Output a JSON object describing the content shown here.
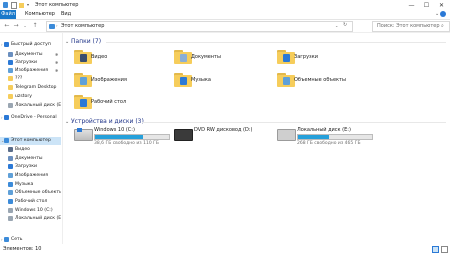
{
  "window": {
    "title": "Этот компьютер",
    "minimize_glyph": "—",
    "maximize_glyph": "☐",
    "close_glyph": "✕"
  },
  "ribbon": {
    "file_tab": "Файл",
    "tabs": [
      "Компьютер",
      "Вид"
    ]
  },
  "address": {
    "path": "Этот компьютер",
    "search_placeholder": "Поиск: Этот компьютер"
  },
  "nav_pane": {
    "items": [
      {
        "label": "Быстрый доступ",
        "icon": "star-icon",
        "color": "#2b79d6",
        "pinned": false,
        "level": 0
      },
      {
        "label": "Документы",
        "icon": "documents-icon",
        "color": "#6a8fbf",
        "pinned": true,
        "level": 1
      },
      {
        "label": "Загрузки",
        "icon": "downloads-icon",
        "color": "#2b79d6",
        "pinned": true,
        "level": 1
      },
      {
        "label": "Изображения",
        "icon": "pictures-icon",
        "color": "#5fa0d8",
        "pinned": true,
        "level": 1
      },
      {
        "label": "???",
        "icon": "folder-icon",
        "color": "#f6cd5b",
        "pinned": false,
        "level": 1
      },
      {
        "label": "Telegram Desktop",
        "icon": "folder-icon",
        "color": "#f6cd5b",
        "pinned": false,
        "level": 1
      },
      {
        "label": "uzstory",
        "icon": "folder-icon",
        "color": "#f6cd5b",
        "pinned": false,
        "level": 1
      },
      {
        "label": "Локальный диск (E:)",
        "icon": "drive-icon",
        "color": "#9aa6b2",
        "pinned": false,
        "level": 1
      },
      {
        "label": "OneDrive - Personal",
        "icon": "onedrive-icon",
        "color": "#2b79d6",
        "pinned": false,
        "level": 0
      },
      {
        "label": "Этот компьютер",
        "icon": "computer-icon",
        "color": "#3c8bd9",
        "pinned": false,
        "level": 0,
        "selected": true
      },
      {
        "label": "Видео",
        "icon": "video-icon",
        "color": "#5a6d8a",
        "pinned": false,
        "level": 1
      },
      {
        "label": "Документы",
        "icon": "documents-icon",
        "color": "#6a8fbf",
        "pinned": false,
        "level": 1
      },
      {
        "label": "Загрузки",
        "icon": "downloads-icon",
        "color": "#2b79d6",
        "pinned": false,
        "level": 1
      },
      {
        "label": "Изображения",
        "icon": "pictures-icon",
        "color": "#5fa0d8",
        "pinned": false,
        "level": 1
      },
      {
        "label": "Музыка",
        "icon": "music-icon",
        "color": "#3c8bd9",
        "pinned": false,
        "level": 1
      },
      {
        "label": "Объемные объекты",
        "icon": "3d-objects-icon",
        "color": "#5fa0d8",
        "pinned": false,
        "level": 1
      },
      {
        "label": "Рабочий стол",
        "icon": "desktop-icon",
        "color": "#3c8bd9",
        "pinned": false,
        "level": 1
      },
      {
        "label": "Windows 10 (C:)",
        "icon": "drive-icon",
        "color": "#9aa6b2",
        "pinned": false,
        "level": 1
      },
      {
        "label": "Локальный диск (E:)",
        "icon": "drive-icon",
        "color": "#9aa6b2",
        "pinned": false,
        "level": 1
      },
      {
        "label": "Сеть",
        "icon": "network-icon",
        "color": "#3c8bd9",
        "pinned": false,
        "level": 0
      }
    ]
  },
  "folders_section": {
    "header": "Папки (7)",
    "items": [
      {
        "label": "Видео",
        "icon": "video-folder-icon",
        "accent": "#3a4e6f"
      },
      {
        "label": "Документы",
        "icon": "documents-folder-icon",
        "accent": "#8aaed6"
      },
      {
        "label": "Загрузки",
        "icon": "downloads-folder-icon",
        "accent": "#2b79d6"
      },
      {
        "label": "Изображения",
        "icon": "pictures-folder-icon",
        "accent": "#5fa0d8"
      },
      {
        "label": "Музыка",
        "icon": "music-folder-icon",
        "accent": "#2b79d6"
      },
      {
        "label": "Объемные объекты",
        "icon": "3d-objects-folder-icon",
        "accent": "#5fa0d8"
      },
      {
        "label": "Рабочий стол",
        "icon": "desktop-folder-icon",
        "accent": "#2b79d6"
      }
    ]
  },
  "drives_section": {
    "header": "Устройства и диски (3)",
    "items": [
      {
        "label": "Windows 10 (C:)",
        "sub": "38,6 ГБ свободно из 110 ГБ",
        "used_fraction": 0.65,
        "icon": "windows-drive-icon",
        "has_bar": true
      },
      {
        "label": "DVD RW дисковод (D:)",
        "sub": "",
        "used_fraction": 0,
        "icon": "dvd-drive-icon",
        "has_bar": false
      },
      {
        "label": "Локальный диск (E:)",
        "sub": "268 ГБ свободно из 465 ГБ",
        "used_fraction": 0.42,
        "icon": "local-drive-icon",
        "has_bar": true
      }
    ]
  },
  "status": {
    "items_count": "Элементов: 10"
  }
}
